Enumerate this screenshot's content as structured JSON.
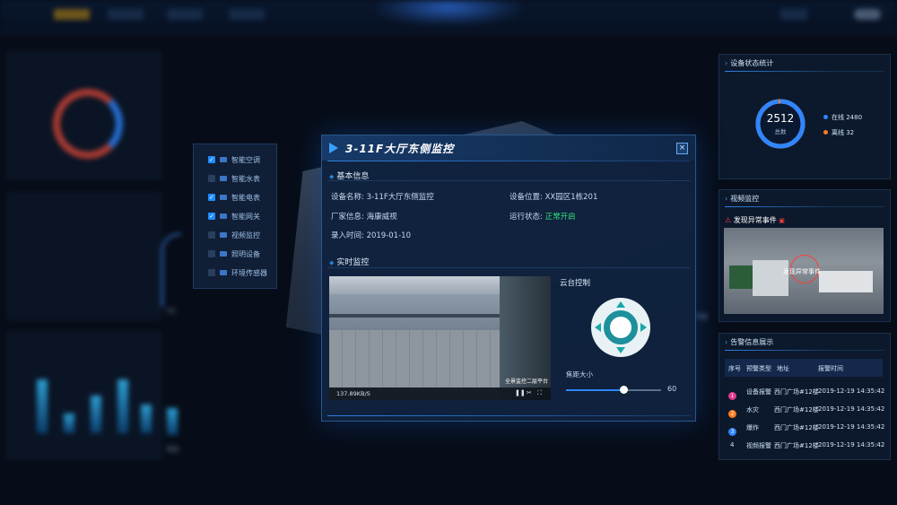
{
  "modal": {
    "title": "3-11F大厅东侧监控",
    "basic_info_title": "基本信息",
    "device_name_label": "设备名称:",
    "device_name": "3-11F大厅东侧监控",
    "device_location_label": "设备位置:",
    "device_location": "XX园区1栋201",
    "vendor_label": "厂家信息:",
    "vendor": "海康威视",
    "status_label": "运行状态:",
    "status": "正常开启",
    "entry_time_label": "录入时间:",
    "entry_time": "2019-01-10",
    "live_title": "实时监控",
    "video_rate": "137.89KB/S",
    "video_overlay": "全景监控二层平台",
    "ptz_title": "云台控制",
    "zoom_label": "焦距大小",
    "zoom_value": "60",
    "zoom_level": 0.6,
    "close_glyph": "×"
  },
  "floor_menu": [
    {
      "label": "智能空调",
      "checked": true
    },
    {
      "label": "智能水表",
      "checked": false
    },
    {
      "label": "智能电表",
      "checked": true
    },
    {
      "label": "智能网关",
      "checked": true
    },
    {
      "label": "视频监控",
      "checked": false
    },
    {
      "label": "照明设备",
      "checked": false
    },
    {
      "label": "环境传感器",
      "checked": false
    }
  ],
  "device_status": {
    "title": "设备状态统计",
    "total": "2512",
    "total_label": "总数",
    "online_label": "在线 2480",
    "offline_label": "离线 32",
    "online_color": "#2f86ff",
    "offline_color": "#ff7a1f",
    "online_fraction": 0.987
  },
  "video_panel": {
    "title": "视频监控",
    "alert": "发现异常事件",
    "overlay": "发现异常事件",
    "alert_color": "#ff3b3b"
  },
  "alarm_panel": {
    "title": "告警信息展示",
    "headers": [
      "序号",
      "预警类型",
      "地址",
      "报警时间"
    ],
    "rows": [
      {
        "no": "1",
        "type": "设备报警",
        "addr": "西门广场#12楼",
        "time": "2019-12-19 14:35:42",
        "color": "#e23a8c"
      },
      {
        "no": "2",
        "type": "水灾",
        "addr": "西门广场#12楼",
        "time": "2019-12-19 14:35:42",
        "color": "#ff7a1f"
      },
      {
        "no": "3",
        "type": "爆炸",
        "addr": "西门广场#12楼",
        "time": "2019-12-19 14:35:42",
        "color": "#2f86ff"
      },
      {
        "no": "4",
        "type": "视频报警",
        "addr": "西门广场#12楼",
        "time": "2019-12-19 14:35:42",
        "color": ""
      }
    ]
  },
  "background_labels": {
    "month": "7月",
    "gateway": "网关",
    "brightness_hint": "亮度"
  }
}
